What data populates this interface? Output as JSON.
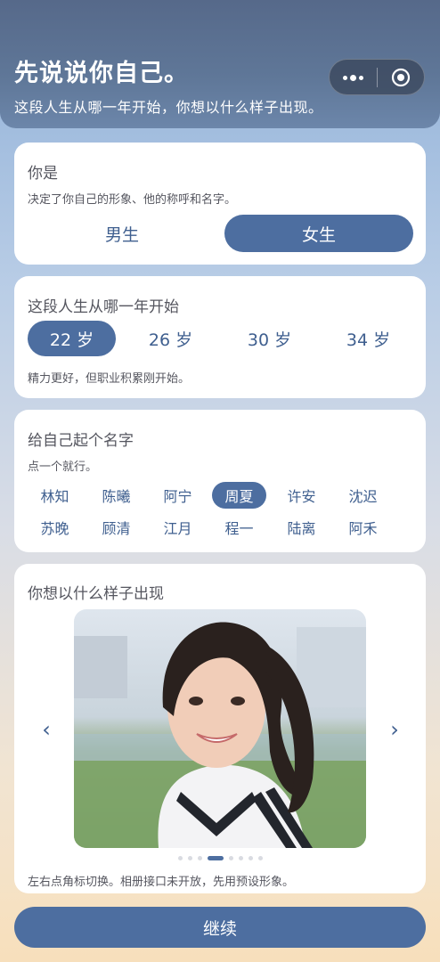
{
  "header": {
    "title": "先说说你自己。",
    "subtitle": "这段人生从哪一年开始，你想以什么样子出现。",
    "menu_icon": "more-dots-icon",
    "close_icon": "target-circle-icon"
  },
  "gender": {
    "title": "你是",
    "hint": "决定了你自己的形象、他的称呼和名字。",
    "options": [
      "男生",
      "女生"
    ],
    "selected": "女生"
  },
  "start_age": {
    "title": "这段人生从哪一年开始",
    "options": [
      "22 岁",
      "26 岁",
      "30 岁",
      "34 岁"
    ],
    "selected": "22 岁",
    "description": "精力更好，但职业积累刚开始。"
  },
  "name": {
    "title": "给自己起个名字",
    "hint": "点一个就行。",
    "options": [
      "林知",
      "陈曦",
      "阿宁",
      "周夏",
      "许安",
      "沈迟",
      "苏晚",
      "顾清",
      "江月",
      "程一",
      "陆离",
      "阿禾"
    ],
    "selected": "周夏"
  },
  "appearance": {
    "title": "你想以什么样子出现",
    "prev_arrow": "‹",
    "next_arrow": "›",
    "page_count": 8,
    "current_page": 4,
    "note": "左右点角标切换。相册接口未开放，先用预设形象。"
  },
  "footer": {
    "continue_label": "继续"
  },
  "colors": {
    "accent": "#4d6ea0",
    "accent_text": "#3f5f8f",
    "header_bg": "#5f7798"
  }
}
